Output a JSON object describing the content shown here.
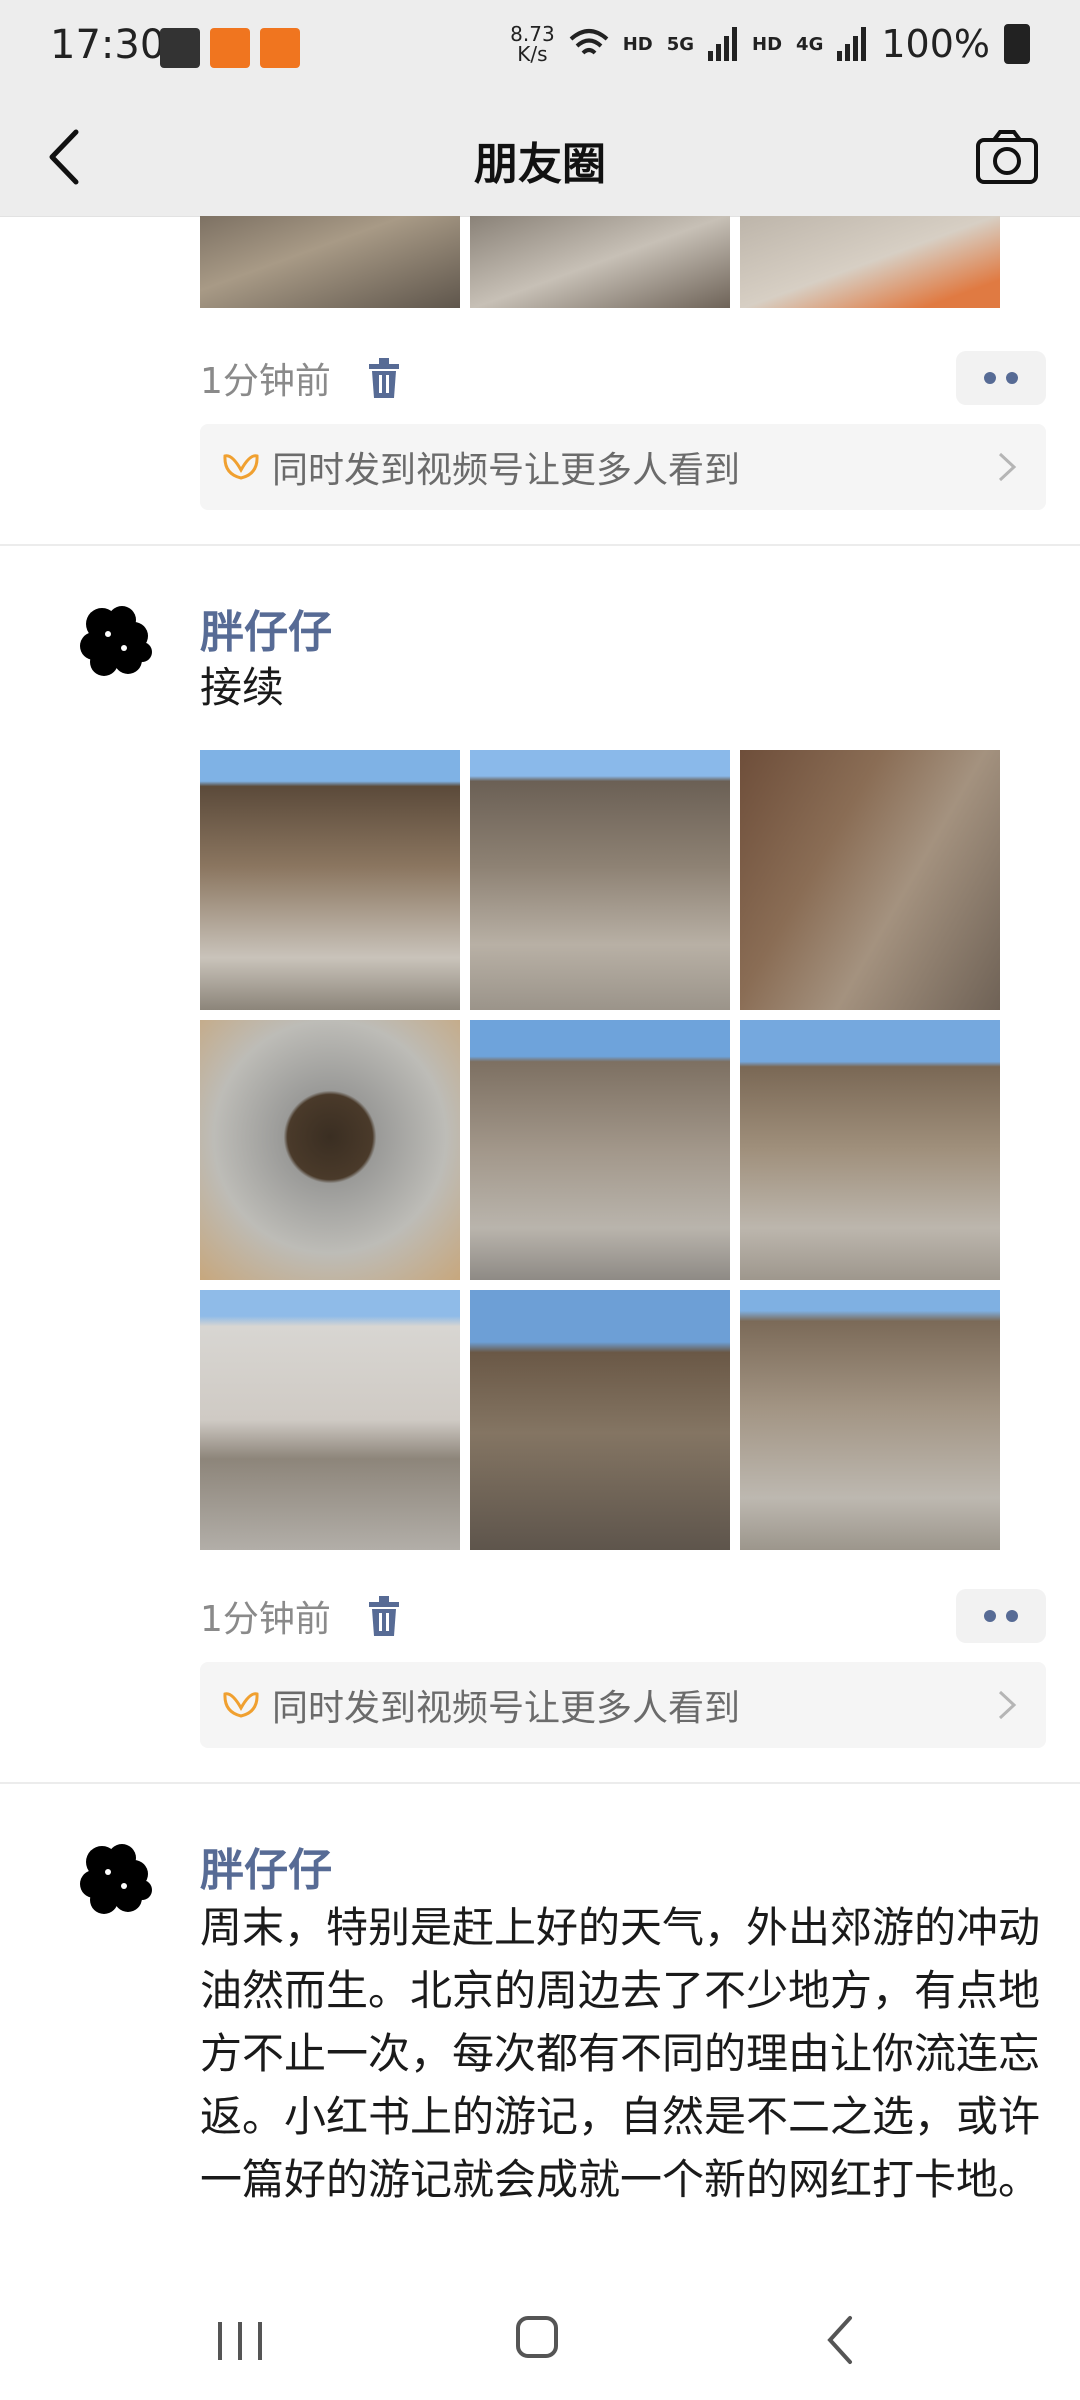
{
  "status_bar": {
    "time": "17:30",
    "net_speed_value": "8.73",
    "net_speed_unit": "K/s",
    "hd_1": "HD",
    "net_5g": "5G",
    "hd_2": "HD",
    "net_4g": "4G",
    "battery": "100%",
    "notify_icons": [
      "gallery-icon",
      "app-badge-icon",
      "app-badge-icon"
    ]
  },
  "nav": {
    "title": "朋友圈",
    "back_icon": "chevron-left-icon",
    "camera_icon": "camera-icon"
  },
  "posts": [
    {
      "time": "1分钟前",
      "channels_text": "同时发到视频号让更多人看到",
      "partial_images": [
        "stone-wall-alley",
        "dog-on-path",
        "stone-steps-house"
      ]
    },
    {
      "name": "胖仔仔",
      "text": "接续",
      "time": "1分钟前",
      "channels_text": "同时发到视频号让更多人看到",
      "images": [
        "old-wooden-house",
        "stone-alley",
        "stone-wall-lane",
        "window-in-wall",
        "courtyard-lamppost",
        "millstone-courtyard",
        "white-wall-house",
        "stone-wall-village",
        "old-house-front"
      ]
    },
    {
      "name": "胖仔仔",
      "text": "周末，特别是赶上好的天气，外出郊游的冲动油然而生。北京的周边去了不少地方，有点地方不止一次，每次都有不同的理由让你流连忘返。小红书上的游记，自然是不二之选，或许一篇好的游记就会成就一个新的网红打卡地。"
    }
  ],
  "colors": {
    "nickname": "#576b95",
    "header_bg": "#ededed",
    "channels_accent": "#f0a030"
  }
}
